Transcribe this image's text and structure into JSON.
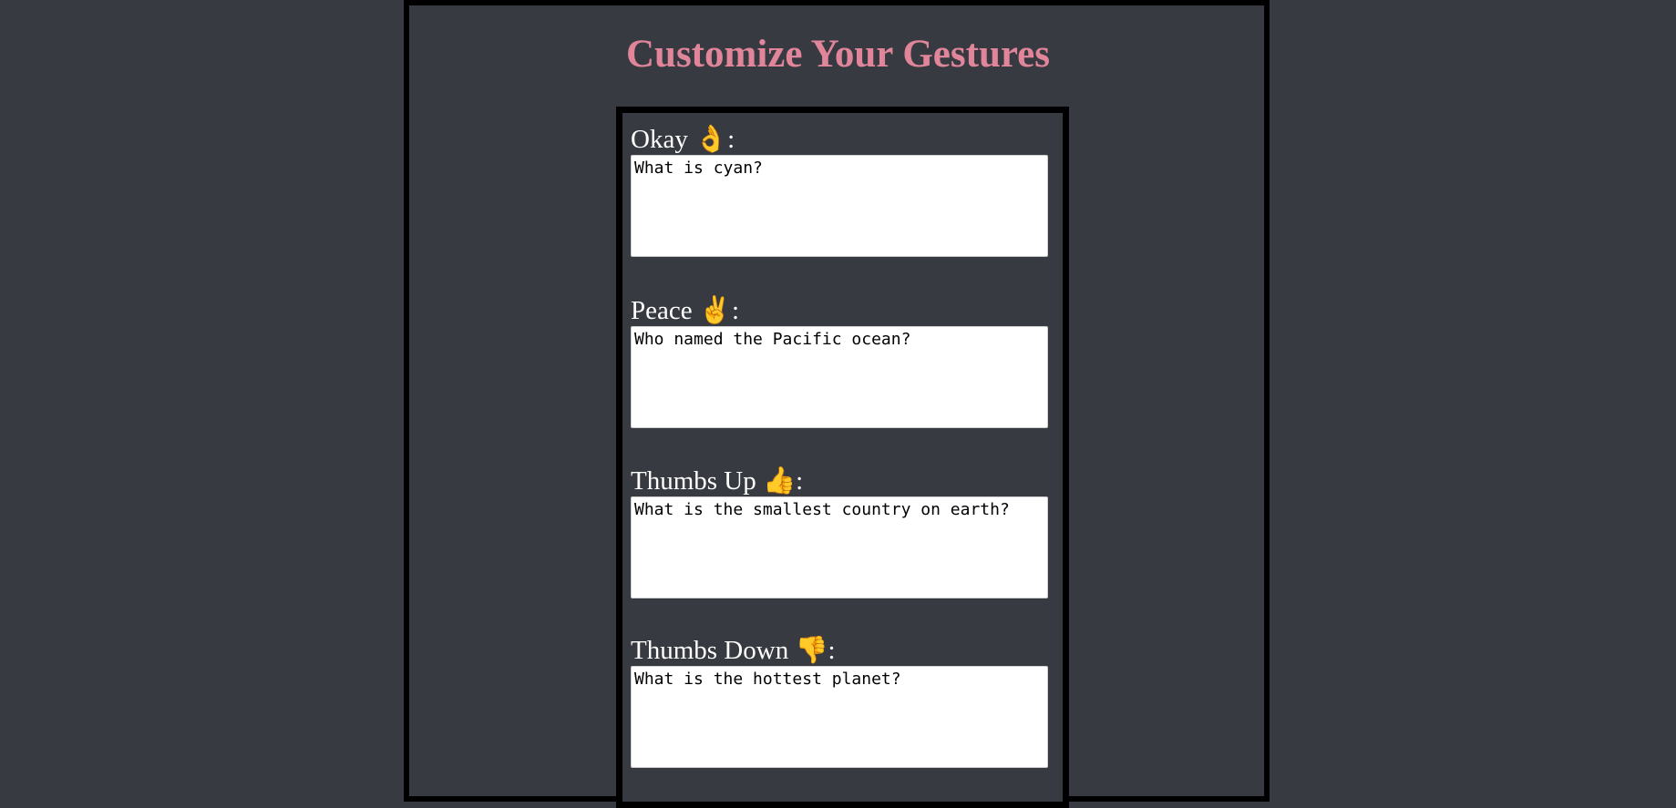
{
  "page": {
    "title": "Customize Your Gestures"
  },
  "gestures": [
    {
      "label": "Okay 👌:",
      "value": "What is cyan?"
    },
    {
      "label": "Peace ✌️:",
      "value": "Who named the Pacific ocean?"
    },
    {
      "label": "Thumbs Up 👍:",
      "value": "What is the smallest country on earth?"
    },
    {
      "label": "Thumbs Down 👎:",
      "value": "What is the hottest planet?"
    }
  ],
  "colors": {
    "background": "#383a42",
    "title": "#e0859a",
    "border": "#000000"
  }
}
